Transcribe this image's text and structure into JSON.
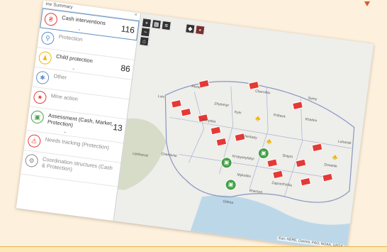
{
  "panel": {
    "title": "ine Summary",
    "close_glyph": "×",
    "rows": [
      {
        "label": "Cash interventions",
        "count": "116",
        "icon": "cash-icon",
        "color": "#e53935",
        "state": "selected"
      },
      {
        "label": "Protection",
        "count": "",
        "icon": "protection-icon",
        "color": "#5b8fc7",
        "state": "faded"
      },
      {
        "label": "Child protection",
        "count": "86",
        "icon": "child-icon",
        "color": "#f4b400",
        "state": "normal"
      },
      {
        "label": "Other",
        "count": "",
        "icon": "other-icon",
        "color": "#5b8fc7",
        "state": "faded"
      },
      {
        "label": "Mine action",
        "count": "",
        "icon": "mine-icon",
        "color": "#e53935",
        "state": "faded"
      },
      {
        "label": "Assessment (Cash, Market, Protection)",
        "count": "13",
        "icon": "assessment-icon",
        "color": "#43a047",
        "state": "normal"
      },
      {
        "label": "Needs tracking (Protection)",
        "count": "",
        "icon": "needs-icon",
        "color": "#e53935",
        "state": "faded"
      },
      {
        "label": "Coordination structures (Cash & Protection)",
        "count": "",
        "icon": "coordination-icon",
        "color": "#888888",
        "state": "faded"
      }
    ]
  },
  "map": {
    "attribution": "Esri, HERE, Garmin, FAO, NOAA, USGS",
    "cities": [
      "Kyiv",
      "Lviv",
      "Kharkiv",
      "Dnipro",
      "Odesa",
      "Vinnytsia",
      "Chernivtsi",
      "Zaporizhzhia",
      "Kherson",
      "Mykolaiv",
      "Poltava",
      "Chernihiv",
      "Zhytomyr",
      "Rivne",
      "Sumy",
      "Donetsk",
      "Luhansk",
      "Uzhhorod",
      "Cherkasy",
      "Kropyvnytskyi"
    ]
  },
  "toolbar": {
    "zoom_in": "+",
    "zoom_out": "−",
    "home": "⌂"
  },
  "colors": {
    "cash": "#e53935",
    "child": "#f4b400",
    "assessment": "#43a047",
    "border": "#9ea9cf"
  }
}
